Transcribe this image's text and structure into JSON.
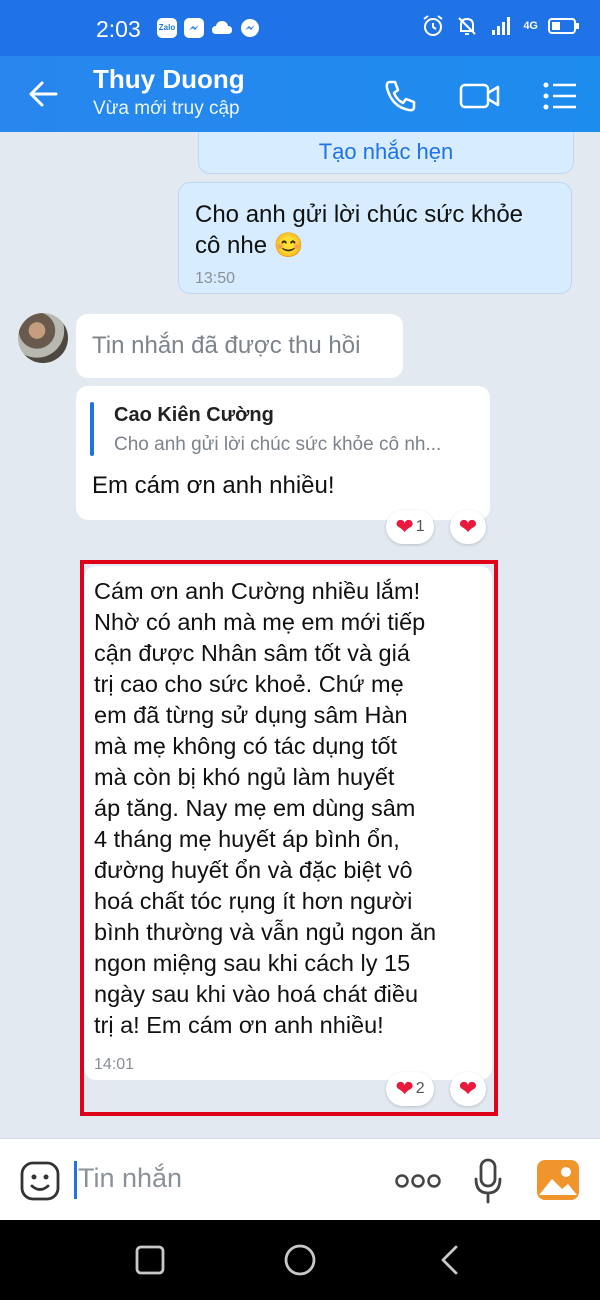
{
  "status_bar": {
    "time": "2:03",
    "notification_icons": [
      "zalo-icon",
      "messenger-icon",
      "cloud-icon",
      "messenger-icon"
    ],
    "zalo_label": "Zalo",
    "network_label": "4G",
    "system_icons": [
      "alarm-icon",
      "mute-icon",
      "signal-icon",
      "battery-icon"
    ]
  },
  "header": {
    "title": "Thuy Duong",
    "subtitle": "Vừa mới truy cập",
    "icons": [
      "back-arrow-icon",
      "phone-icon",
      "video-call-icon",
      "menu-list-icon"
    ]
  },
  "messages": [
    {
      "id": "m0",
      "side": "self",
      "type": "reminder",
      "text": "Tạo nhắc hẹn"
    },
    {
      "id": "m1",
      "side": "self",
      "lines": [
        "Cho anh gửi lời chúc sức khỏe",
        "cô nhe"
      ],
      "emoji": "😊",
      "time": "13:50"
    },
    {
      "id": "m2",
      "side": "other",
      "text": "Tin nhắn đã được thu hồi"
    },
    {
      "id": "m3",
      "side": "other",
      "quote_author": "Cao Kiên Cường",
      "quote_text": "Cho anh gửi lời chúc sức khỏe cô nh...",
      "text": "Em cám ơn anh nhiều!",
      "reactions_count": "1"
    },
    {
      "id": "m4",
      "side": "other",
      "lines": [
        "Cám ơn anh Cường nhiều lắm!",
        "Nhờ có anh mà mẹ em mới tiếp",
        "cận được Nhân sâm tốt và giá",
        "trị cao cho sức khoẻ. Chứ mẹ",
        "em đã từng sử dụng sâm Hàn",
        "mà mẹ không có tác dụng tốt",
        "mà còn bị khó ngủ làm huyết",
        "áp tăng. Nay mẹ em dùng sâm",
        "4 tháng mẹ huyết áp bình ổn,",
        "đường huyết ổn và đặc biệt vô",
        "hoá chất tóc rụng ít hơn người",
        "bình thường và vẫn ngủ ngon ăn",
        "ngon miệng sau khi cách ly 15",
        "ngày sau khi vào hoá chát điều",
        "trị a! Em cám ơn anh nhiều!"
      ],
      "time": "14:01",
      "reactions_count": "2"
    }
  ],
  "colors": {
    "accent": "#1f73e6",
    "highlight": "#e1001a",
    "heart": "#e8193c"
  },
  "input_bar": {
    "placeholder": "Tin nhắn",
    "icons": [
      "sticker-icon",
      "more-options-icon",
      "microphone-icon",
      "image-gallery-icon"
    ]
  },
  "nav_bar": {
    "icons": [
      "recent-apps-icon",
      "home-icon",
      "back-icon"
    ]
  }
}
